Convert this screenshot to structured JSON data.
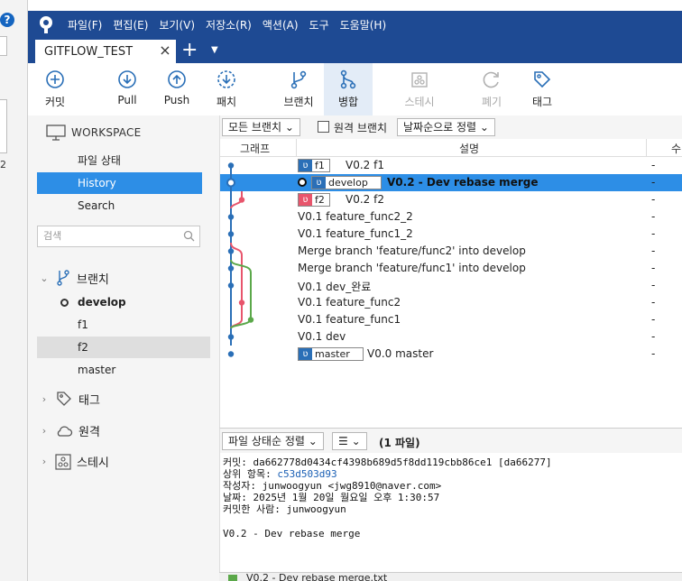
{
  "colors": {
    "titlebar": "#1e4a93",
    "selection": "#2d8ee6",
    "graph_blue": "#2a6fb7",
    "graph_red": "#e8556c",
    "graph_green": "#5ba84a"
  },
  "menu": [
    "파일(F)",
    "편집(E)",
    "보기(V)",
    "저장소(R)",
    "액션(A)",
    "도구",
    "도움말(H)"
  ],
  "tab": {
    "title": "GITFLOW_TEST",
    "close": "×",
    "add": "+"
  },
  "toolbar": {
    "commit": "커밋",
    "pull": "Pull",
    "push": "Push",
    "fetch": "패치",
    "branch": "브랜치",
    "merge": "병합",
    "stash": "스테시",
    "discard": "폐기",
    "tag": "태그"
  },
  "sidebar": {
    "workspace": "WORKSPACE",
    "nav": [
      "파일 상태",
      "History",
      "Search"
    ],
    "search_placeholder": "검색",
    "branches_title": "브랜치",
    "branches": [
      "develop",
      "f1",
      "f2",
      "master"
    ],
    "tags_title": "태그",
    "remotes_title": "원격",
    "stash_title": "스테시"
  },
  "filter": {
    "branches": "모든 브랜치 ⌄",
    "remote": "원격 브랜치",
    "sort": "날짜순으로 정렬 ⌄"
  },
  "columns": {
    "graph": "그래프",
    "desc": "설명",
    "date": "수"
  },
  "commits": [
    {
      "tag": "f1",
      "message": "V0.2 f1",
      "date": "-"
    },
    {
      "tag": "develop",
      "message": "V0.2 - Dev  rebase merge",
      "date": "-"
    },
    {
      "tag": "f2",
      "message": "V0.2 f2",
      "date": "-"
    },
    {
      "tag": "",
      "message": "V0.1 feature_func2_2",
      "date": "-"
    },
    {
      "tag": "",
      "message": "V0.1 feature_func1_2",
      "date": "-"
    },
    {
      "tag": "",
      "message": "Merge branch 'feature/func2' into develop",
      "date": "-"
    },
    {
      "tag": "",
      "message": "Merge branch 'feature/func1' into develop",
      "date": "-"
    },
    {
      "tag": "",
      "message": "V0.1 dev_완료",
      "date": "-"
    },
    {
      "tag": "",
      "message": "V0.1 feature_func2",
      "date": "-"
    },
    {
      "tag": "",
      "message": "V0.1 feature_func1",
      "date": "-"
    },
    {
      "tag": "",
      "message": "V0.1 dev",
      "date": "-"
    },
    {
      "tag": "master",
      "message": "V0.0 master",
      "date": "-"
    }
  ],
  "detail": {
    "sort": "파일 상태순 정렬 ⌄",
    "view": "☰ ⌄",
    "file_count": "(1 파일)",
    "commit_label": "커밋:",
    "commit_hash": "da662778d0434cf4398b689d5f8dd119cbb86ce1 [da66277]",
    "parent_label": "상위 항목:",
    "parent_hash": "c53d503d93",
    "author_label": "작성자:",
    "author": "junwoogyun <jwg8910@naver.com>",
    "date_label": "날짜:",
    "date": "2025년 1월 20일 월요일 오후 1:30:57",
    "committer_label": "커밋한 사람:",
    "committer": "junwoogyun",
    "message": "V0.2 - Dev  rebase merge",
    "file": "V0.2 - Dev  rebase merge.txt"
  },
  "background_window": {
    "help": "?",
    "number": "2"
  }
}
